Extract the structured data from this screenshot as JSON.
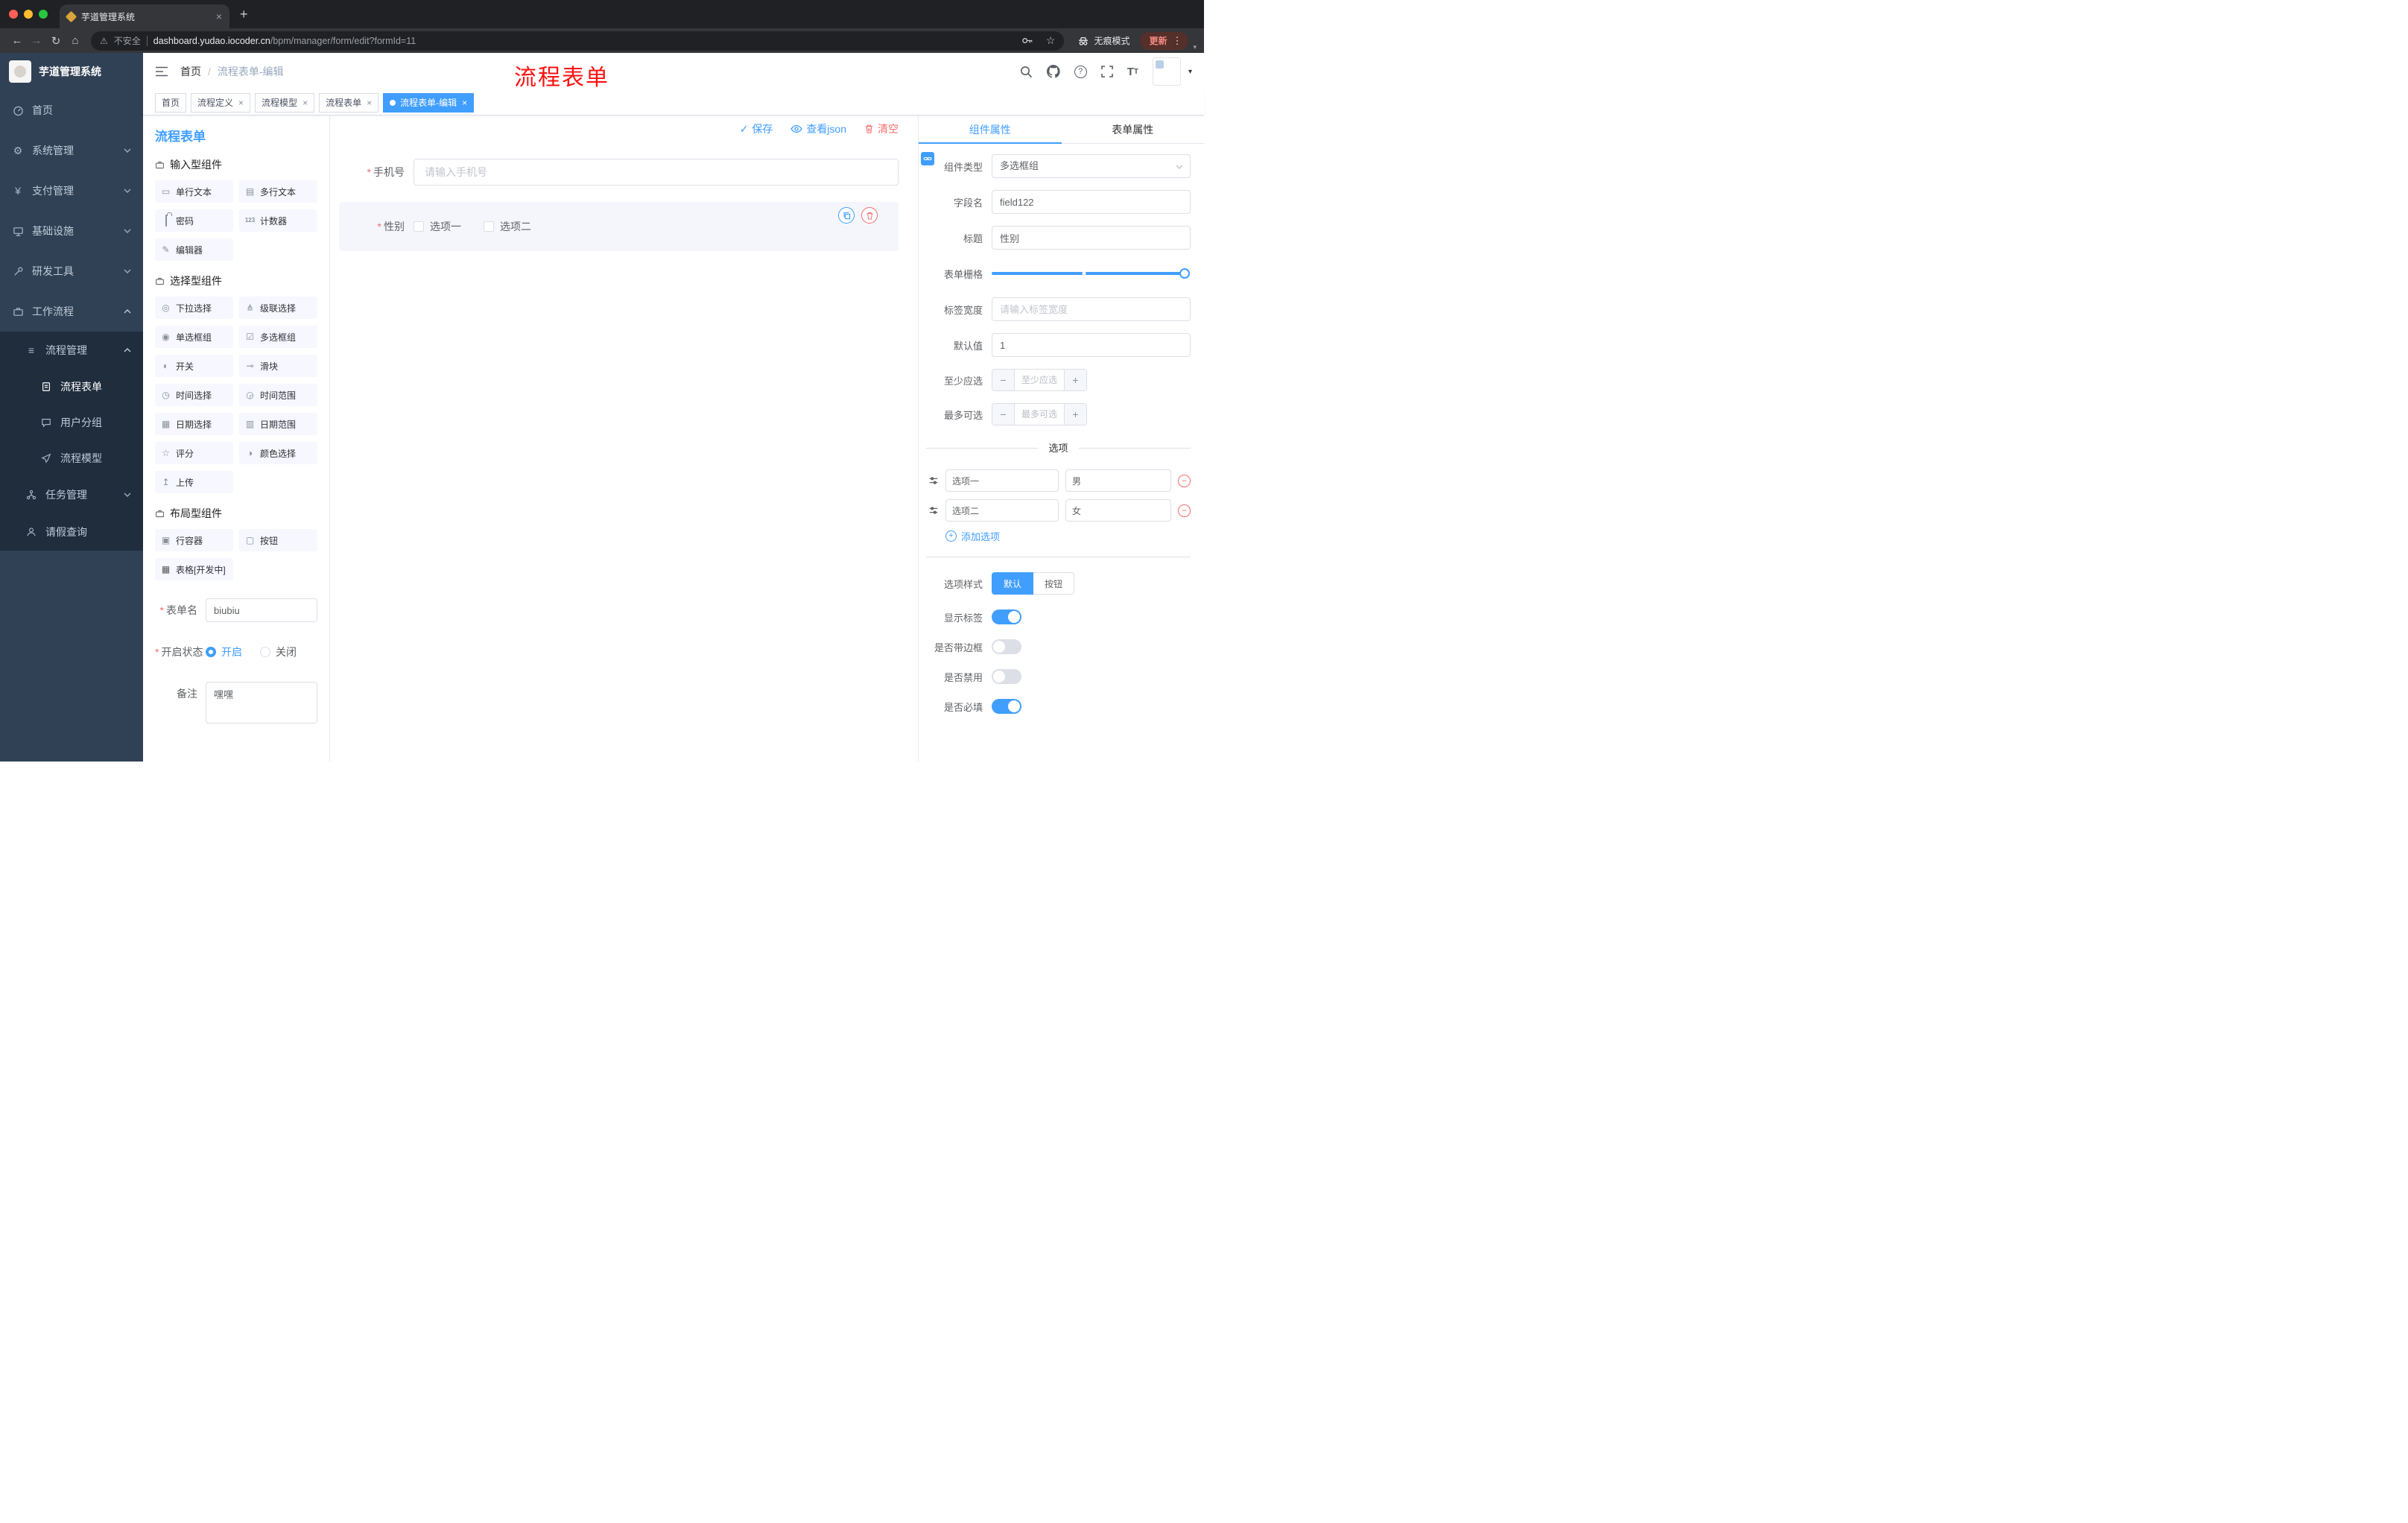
{
  "browser": {
    "tab_title": "芋道管理系统",
    "security_label": "不安全",
    "url_domain": "dashboard.yudao.iocoder.cn",
    "url_path": "/bpm/manager/form/edit?formId=11",
    "incognito_label": "无痕模式",
    "update_label": "更新"
  },
  "icons": {
    "close": "×",
    "new_tab": "+",
    "back": "←",
    "forward": "→",
    "reload": "↻",
    "home": "⌂",
    "star": "☆",
    "warning": "⚠",
    "more_v": "⋮",
    "caret": "▾",
    "slash": "/",
    "check": "✓",
    "minus": "−",
    "plus": "+",
    "question": "?",
    "font_big": "T",
    "font_small": "T",
    "comp_single_text": "▭",
    "comp_multi_text": "▤",
    "comp_counter": "123",
    "comp_editor": "✎",
    "comp_select": "◎",
    "comp_cascader": "⋔",
    "comp_radio": "◉",
    "comp_checkbox": "☑",
    "comp_switch": "◐",
    "comp_slider": "⊸",
    "comp_time": "◷",
    "comp_time_range": "◶",
    "comp_date": "▦",
    "comp_date_range": "▥",
    "comp_rate": "☆",
    "comp_color": "◑",
    "comp_upload": "↥",
    "comp_row": "▣",
    "comp_button": "▢",
    "comp_table": "▦",
    "gear": "⚙",
    "yen": "¥",
    "menu_list": "≡"
  },
  "sidebar": {
    "logo_title": "芋道管理系统",
    "menu": {
      "home": "首页",
      "system": "系统管理",
      "payment": "支付管理",
      "infra": "基础设施",
      "devtools": "研发工具",
      "workflow": "工作流程",
      "process_mgmt": "流程管理",
      "process_form": "流程表单",
      "user_group": "用户分组",
      "process_model": "流程模型",
      "task_mgmt": "任务管理",
      "leave_query": "请假查询"
    }
  },
  "header": {
    "breadcrumb_home": "首页",
    "breadcrumb_current": "流程表单-编辑",
    "annotation": "流程表单"
  },
  "tags": [
    "首页",
    "流程定义",
    "流程模型",
    "流程表单",
    "流程表单-编辑"
  ],
  "designer": {
    "panel_title": "流程表单",
    "save": "保存",
    "view_json": "查看json",
    "clear": "清空",
    "groups": [
      {
        "title": "输入型组件",
        "items": [
          "单行文本",
          "多行文本",
          "密码",
          "计数器",
          "编辑器"
        ]
      },
      {
        "title": "选择型组件",
        "items": [
          "下拉选择",
          "级联选择",
          "单选框组",
          "多选框组",
          "开关",
          "滑块",
          "时间选择",
          "时间范围",
          "日期选择",
          "日期范围",
          "评分",
          "颜色选择",
          "上传"
        ]
      },
      {
        "title": "布局型组件",
        "items": [
          "行容器",
          "按钮",
          "表格[开发中]"
        ]
      }
    ],
    "meta": {
      "form_name_label": "表单名",
      "form_name_value": "biubiu",
      "status_label": "开启状态",
      "status_on": "开启",
      "status_off": "关闭",
      "remark_label": "备注",
      "remark_value": "嘿嘿"
    },
    "canvas": {
      "phone_label": "手机号",
      "phone_placeholder": "请输入手机号",
      "gender_label": "性别",
      "gender_opt1": "选项一",
      "gender_opt2": "选项二"
    }
  },
  "props": {
    "tab_component": "组件属性",
    "tab_form": "表单属性",
    "component_type_label": "组件类型",
    "component_type_value": "多选框组",
    "field_name_label": "字段名",
    "field_name_value": "field122",
    "title_label": "标题",
    "title_value": "性别",
    "grid_label": "表单栅格",
    "label_width_label": "标签宽度",
    "label_width_placeholder": "请输入标签宽度",
    "default_label": "默认值",
    "default_value": "1",
    "min_label": "至少应选",
    "min_placeholder": "至少应选",
    "max_label": "最多可选",
    "max_placeholder": "最多可选",
    "options_title": "选项",
    "options": [
      {
        "label": "选项一",
        "value": "男"
      },
      {
        "label": "选项二",
        "value": "女"
      }
    ],
    "add_option": "添加选项",
    "style_label": "选项样式",
    "style_default": "默认",
    "style_button": "按钮",
    "show_label": "显示标签",
    "border_label": "是否带边框",
    "disabled_label": "是否禁用",
    "required_label": "是否必填",
    "switch_states": {
      "show_label": true,
      "border": false,
      "disabled": false,
      "required": true
    }
  },
  "colors": {
    "primary": "#409eff",
    "danger": "#f56c6c",
    "annotation_red": "#fe1010",
    "sidebar_bg": "#304156",
    "submenu_bg": "#1f2d3d",
    "chrome_bg": "#202124",
    "toolbar_bg": "#35363a",
    "update_text": "#f28b82"
  }
}
